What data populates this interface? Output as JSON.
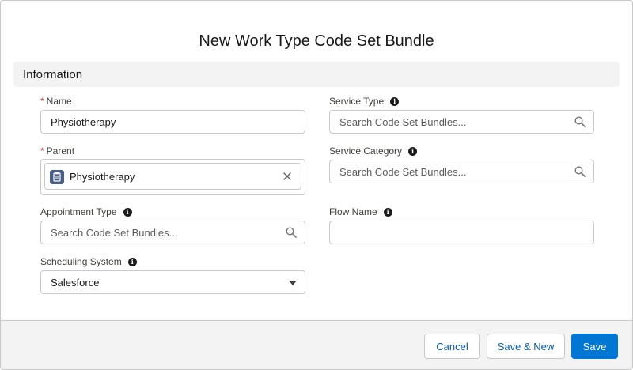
{
  "modal": {
    "title": "New Work Type Code Set Bundle"
  },
  "section": {
    "title": "Information"
  },
  "fields": {
    "name": {
      "label": "Name",
      "required_marker": "*",
      "value": "Physiotherapy"
    },
    "service_type": {
      "label": "Service Type",
      "placeholder": "Search Code Set Bundles..."
    },
    "parent": {
      "label": "Parent",
      "required_marker": "*",
      "selected": "Physiotherapy"
    },
    "service_category": {
      "label": "Service Category",
      "placeholder": "Search Code Set Bundles..."
    },
    "appointment_type": {
      "label": "Appointment Type",
      "placeholder": "Search Code Set Bundles..."
    },
    "flow_name": {
      "label": "Flow Name",
      "value": ""
    },
    "scheduling_system": {
      "label": "Scheduling System",
      "selected": "Salesforce"
    }
  },
  "info_icon_glyph": "i",
  "footer": {
    "cancel_label": "Cancel",
    "save_new_label": "Save & New",
    "save_label": "Save"
  },
  "colors": {
    "brand": "#0176d3",
    "required": "#c23934",
    "neutral_text": "#0b5cab",
    "record_icon_bg": "#4a5d86"
  },
  "icons": {
    "info": "info-icon",
    "search": "search-icon",
    "close": "close-icon",
    "record": "record-icon",
    "dropdown": "chevron-down-icon"
  }
}
